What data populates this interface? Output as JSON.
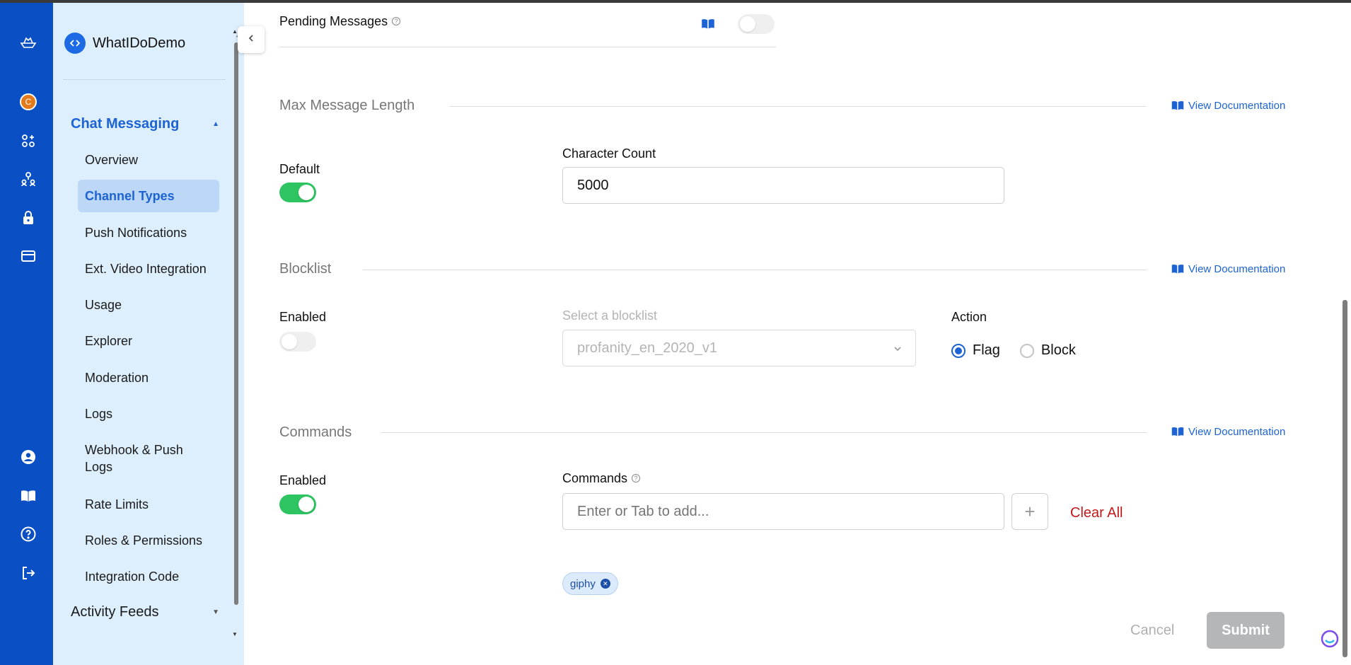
{
  "app": {
    "name": "WhatIDoDemo"
  },
  "rail": {
    "avatar_initial": "C"
  },
  "sidebar": {
    "section_chat": "Chat Messaging",
    "items": [
      {
        "label": "Overview"
      },
      {
        "label": "Channel Types",
        "active": true
      },
      {
        "label": "Push Notifications"
      },
      {
        "label": "Ext. Video Integration"
      },
      {
        "label": "Usage"
      },
      {
        "label": "Explorer"
      },
      {
        "label": "Moderation"
      },
      {
        "label": "Logs"
      },
      {
        "label": "Webhook & Push Logs"
      },
      {
        "label": "Rate Limits"
      },
      {
        "label": "Roles & Permissions"
      },
      {
        "label": "Integration Code"
      }
    ],
    "section_feeds": "Activity Feeds"
  },
  "pending": {
    "label": "Pending Messages",
    "enabled": false
  },
  "max_length": {
    "title": "Max Message Length",
    "doc_link": "View Documentation",
    "default_label": "Default",
    "default_enabled": true,
    "count_label": "Character Count",
    "count_value": "5000"
  },
  "blocklist": {
    "title": "Blocklist",
    "doc_link": "View Documentation",
    "enabled_label": "Enabled",
    "enabled": false,
    "select_label": "Select a blocklist",
    "select_value": "profanity_en_2020_v1",
    "action_label": "Action",
    "actions": [
      {
        "label": "Flag",
        "selected": true
      },
      {
        "label": "Block",
        "selected": false
      }
    ]
  },
  "commands": {
    "title": "Commands",
    "doc_link": "View Documentation",
    "enabled_label": "Enabled",
    "enabled": true,
    "field_label": "Commands",
    "input_placeholder": "Enter or Tab to add...",
    "clear_all": "Clear All",
    "chips": [
      "giphy"
    ]
  },
  "footer": {
    "cancel": "Cancel",
    "submit": "Submit"
  },
  "colors": {
    "rail": "#0a4fc4",
    "sidebar": "#ddeefc",
    "accent": "#1d63d3",
    "toggle_on": "#2ec462",
    "danger": "#c01a1a",
    "submit_disabled": "#b4b6b8"
  }
}
